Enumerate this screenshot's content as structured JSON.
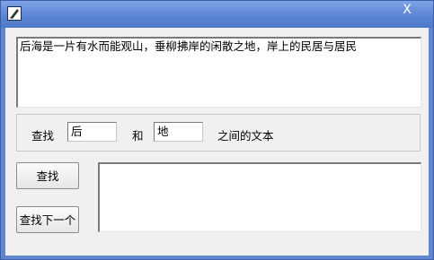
{
  "window": {
    "title": "",
    "close_glyph": "X",
    "icon": "notepad-icon"
  },
  "source": {
    "text": "后海是一片有水而能观山，垂柳拂岸的闲散之地，岸上的民居与居民"
  },
  "search": {
    "find_label": "查找",
    "start_value": "后",
    "and_label": "和",
    "end_value": "地",
    "suffix_label": "之间的文本"
  },
  "buttons": {
    "find": "查找",
    "find_next": "查找下一个"
  },
  "result": {
    "text": ""
  }
}
